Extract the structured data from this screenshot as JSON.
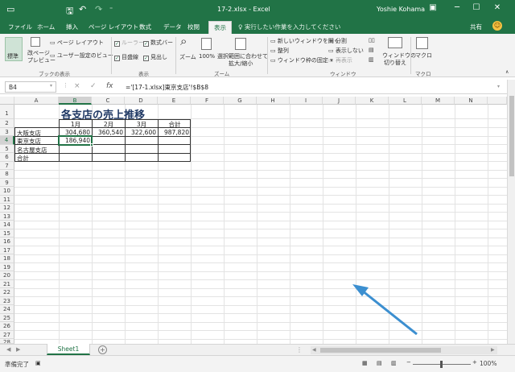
{
  "titlebar": {
    "save_icon": "save-icon",
    "undo_icon": "undo-icon",
    "redo_icon": "redo-icon",
    "doc_title": "17-2.xlsx - Excel",
    "user_name": "Yoshie Kohama",
    "bg_color": "#217346"
  },
  "tabs": [
    {
      "label": "ファイル"
    },
    {
      "label": "ホーム"
    },
    {
      "label": "挿入"
    },
    {
      "label": "ページ レイアウト"
    },
    {
      "label": "数式"
    },
    {
      "label": "データ"
    },
    {
      "label": "校閲"
    },
    {
      "label": "表示",
      "active": true
    }
  ],
  "tell_me": "♀ 実行したい作業を入力してください",
  "share": "共有",
  "ribbon": {
    "normal": "標準",
    "page_break_1": "改ページ",
    "page_break_2": "プレビュー",
    "page_layout": "ページ レイアウト",
    "custom_views": "ユーザー設定のビュー",
    "group_views": "ブックの表示",
    "ruler": "ルーラー",
    "formula_bar": "数式バー",
    "gridlines": "目盛線",
    "headings": "見出し",
    "group_show": "表示",
    "zoom": "ズーム",
    "zoom_100": "100%",
    "zoom_sel_1": "選択範囲に合わせて",
    "zoom_sel_2": "拡大/縮小",
    "group_zoom": "ズーム",
    "new_window": "新しいウィンドウを開く",
    "arrange": "整列",
    "freeze": "ウィンドウ枠の固定",
    "split": "分割",
    "hide": "表示しない",
    "unhide": "再表示",
    "switch_1": "ウィンドウの",
    "switch_2": "切り替え",
    "group_window": "ウィンドウ",
    "macro": "マクロ",
    "group_macro": "マクロ"
  },
  "formula_bar": {
    "name_box": "B4",
    "cancel": "×",
    "enter": "✓",
    "fx": "fx",
    "formula": "='[17-1.xlsx]東京支店'!$B$8"
  },
  "columns": [
    "A",
    "B",
    "C",
    "D",
    "E",
    "F",
    "G",
    "H",
    "I",
    "J",
    "K",
    "L",
    "M",
    "N"
  ],
  "rows": [
    "1",
    "2",
    "3",
    "4",
    "5",
    "6",
    "7",
    "8",
    "9",
    "10",
    "11",
    "12",
    "13",
    "14",
    "15",
    "16",
    "17",
    "18",
    "19",
    "20",
    "21",
    "22",
    "23",
    "24",
    "25",
    "26",
    "27",
    "28"
  ],
  "sheet": {
    "title": "各支店の売上推移",
    "headers": [
      "1月",
      "2月",
      "3月",
      "合計"
    ],
    "branches": [
      "大阪支店",
      "東京支店",
      "名古屋支店",
      "合計"
    ],
    "values": {
      "osaka": [
        "304,680",
        "360,540",
        "322,600",
        "987,820"
      ],
      "tokyo_jan": "186,940"
    },
    "active_cell": "B4"
  },
  "sheet_tab": "Sheet1",
  "status": {
    "text": "準備完了",
    "zoom": "100%"
  },
  "annotation": {
    "color": "#3c8fd0"
  }
}
